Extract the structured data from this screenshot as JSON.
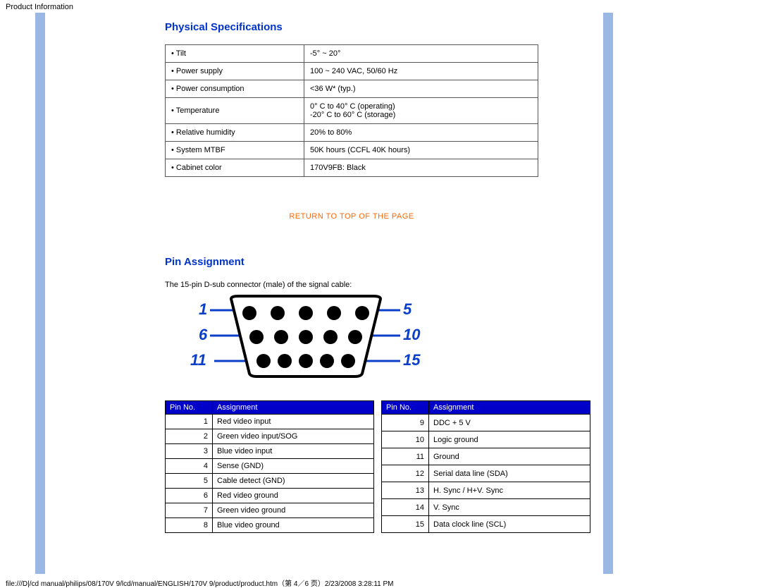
{
  "header": {
    "page_title": "Product Information"
  },
  "sections": {
    "physical": {
      "heading": "Physical Specifications",
      "rows": [
        {
          "label": "• Tilt",
          "value": "-5° ~ 20°"
        },
        {
          "label": "• Power supply",
          "value": "100 ~ 240 VAC, 50/60 Hz"
        },
        {
          "label": "• Power consumption",
          "value": "<36 W* (typ.)"
        },
        {
          "label": "• Temperature",
          "value": "0° C to 40° C (operating)\n-20° C to 60° C (storage)"
        },
        {
          "label": "• Relative humidity",
          "value": "20% to 80%"
        },
        {
          "label": "• System MTBF",
          "value": "50K hours (CCFL 40K hours)"
        },
        {
          "label": "• Cabinet color",
          "value": "170V9FB: Black"
        }
      ]
    },
    "return_link": "RETURN TO TOP OF THE PAGE",
    "pin": {
      "heading": "Pin Assignment",
      "intro": "The 15-pin D-sub connector (male) of the signal cable:",
      "diagram_numbers": {
        "tl": "1",
        "ml": "6",
        "bl": "11",
        "tr": "5",
        "mr": "10",
        "br": "15"
      },
      "columns": {
        "pin_no": "Pin No.",
        "assignment": "Assignment"
      },
      "left_rows": [
        {
          "no": "1",
          "assign": "Red video input"
        },
        {
          "no": "2",
          "assign": "Green video input/SOG"
        },
        {
          "no": "3",
          "assign": "Blue video input"
        },
        {
          "no": "4",
          "assign": "Sense (GND)"
        },
        {
          "no": "5",
          "assign": "Cable detect (GND)"
        },
        {
          "no": "6",
          "assign": "Red video ground"
        },
        {
          "no": "7",
          "assign": "Green video ground"
        },
        {
          "no": "8",
          "assign": "Blue video ground"
        }
      ],
      "right_rows": [
        {
          "no": "9",
          "assign": "DDC + 5 V"
        },
        {
          "no": "10",
          "assign": "Logic ground"
        },
        {
          "no": "11",
          "assign": "Ground"
        },
        {
          "no": "12",
          "assign": "Serial data line (SDA)"
        },
        {
          "no": "13",
          "assign": "H. Sync / H+V. Sync"
        },
        {
          "no": "14",
          "assign": "V. Sync"
        },
        {
          "no": "15",
          "assign": "Data clock line (SCL)"
        }
      ]
    }
  },
  "footer": {
    "text": "file:///D|/cd manual/philips/08/170V 9/lcd/manual/ENGLISH/170V 9/product/product.htm（第 4／6 页）2/23/2008 3:28:11 PM"
  }
}
